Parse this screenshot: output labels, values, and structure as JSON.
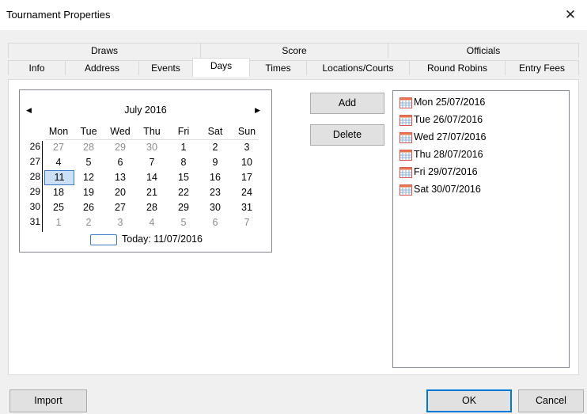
{
  "window": {
    "title": "Tournament Properties"
  },
  "tabs_row1": [
    {
      "label": "Draws"
    },
    {
      "label": "Score"
    },
    {
      "label": "Officials"
    }
  ],
  "tabs_row2": [
    {
      "label": "Info"
    },
    {
      "label": "Address"
    },
    {
      "label": "Events"
    },
    {
      "label": "Days",
      "active": true
    },
    {
      "label": "Times"
    },
    {
      "label": "Locations/Courts"
    },
    {
      "label": "Round Robins"
    },
    {
      "label": "Entry Fees"
    }
  ],
  "calendar": {
    "month_label": "July 2016",
    "prev_icon": "◀",
    "next_icon": "▶",
    "weekdays": [
      "Mon",
      "Tue",
      "Wed",
      "Thu",
      "Fri",
      "Sat",
      "Sun"
    ],
    "weeks": [
      {
        "num": "26",
        "days": [
          {
            "d": "27",
            "grey": true
          },
          {
            "d": "28",
            "grey": true
          },
          {
            "d": "29",
            "grey": true
          },
          {
            "d": "30",
            "grey": true
          },
          {
            "d": "1"
          },
          {
            "d": "2"
          },
          {
            "d": "3"
          }
        ]
      },
      {
        "num": "27",
        "days": [
          {
            "d": "4"
          },
          {
            "d": "5"
          },
          {
            "d": "6"
          },
          {
            "d": "7"
          },
          {
            "d": "8"
          },
          {
            "d": "9"
          },
          {
            "d": "10"
          }
        ]
      },
      {
        "num": "28",
        "days": [
          {
            "d": "11",
            "today": true
          },
          {
            "d": "12"
          },
          {
            "d": "13"
          },
          {
            "d": "14"
          },
          {
            "d": "15"
          },
          {
            "d": "16"
          },
          {
            "d": "17"
          }
        ]
      },
      {
        "num": "29",
        "days": [
          {
            "d": "18"
          },
          {
            "d": "19"
          },
          {
            "d": "20"
          },
          {
            "d": "21"
          },
          {
            "d": "22"
          },
          {
            "d": "23"
          },
          {
            "d": "24"
          }
        ]
      },
      {
        "num": "30",
        "days": [
          {
            "d": "25"
          },
          {
            "d": "26"
          },
          {
            "d": "27"
          },
          {
            "d": "28"
          },
          {
            "d": "29"
          },
          {
            "d": "30"
          },
          {
            "d": "31"
          }
        ]
      },
      {
        "num": "31",
        "days": [
          {
            "d": "1",
            "grey": true
          },
          {
            "d": "2",
            "grey": true
          },
          {
            "d": "3",
            "grey": true
          },
          {
            "d": "4",
            "grey": true
          },
          {
            "d": "5",
            "grey": true
          },
          {
            "d": "6",
            "grey": true
          },
          {
            "d": "7",
            "grey": true
          }
        ]
      }
    ],
    "today_label": "Today: 11/07/2016"
  },
  "buttons": {
    "add": "Add",
    "delete": "Delete",
    "import": "Import",
    "ok": "OK",
    "cancel": "Cancel"
  },
  "days_list": [
    {
      "label": "Mon 25/07/2016",
      "icon": "calendar-icon"
    },
    {
      "label": "Tue 26/07/2016",
      "icon": "calendar-icon"
    },
    {
      "label": "Wed 27/07/2016",
      "icon": "calendar-icon"
    },
    {
      "label": "Thu 28/07/2016",
      "icon": "calendar-icon"
    },
    {
      "label": "Fri 29/07/2016",
      "icon": "calendar-icon"
    },
    {
      "label": "Sat 30/07/2016",
      "icon": "calendar-icon"
    }
  ],
  "colors": {
    "accent": "#0078d7",
    "today_fill": "#cce0f5",
    "grey_text": "#8c8c8c"
  }
}
